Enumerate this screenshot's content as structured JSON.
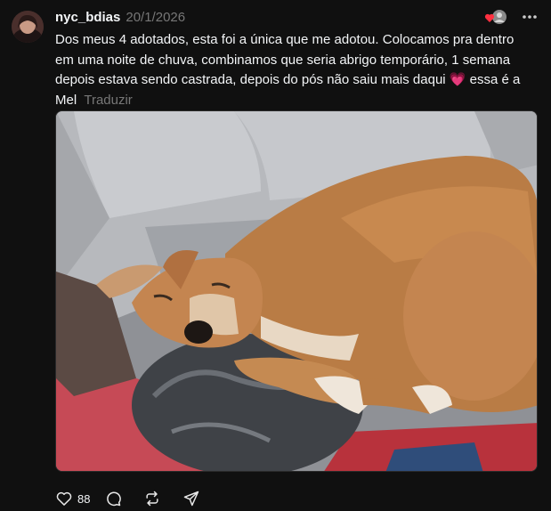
{
  "post": {
    "username": "nyc_bdias",
    "timestamp": "20/1/2026",
    "text_main": "Dos meus 4 adotados, esta foi a única que me adotou. Colocamos pra dentro em uma noite de chuva, combinamos que seria abrigo temporário, 1 semana depois estava sendo castrada, depois do pós não saiu mais daqui",
    "emoji": "💗",
    "text_tail": "essa é a Mel",
    "translate_label": "Traduzir",
    "like_count": "88"
  },
  "icons": {
    "like": "heart-icon",
    "reply": "comment-icon",
    "repost": "repost-icon",
    "share": "share-icon",
    "more": "more-dots-icon"
  },
  "colors": {
    "background": "#101010",
    "text": "#f3f5f7",
    "muted": "#777777",
    "heart_badge": "#ff3040"
  }
}
